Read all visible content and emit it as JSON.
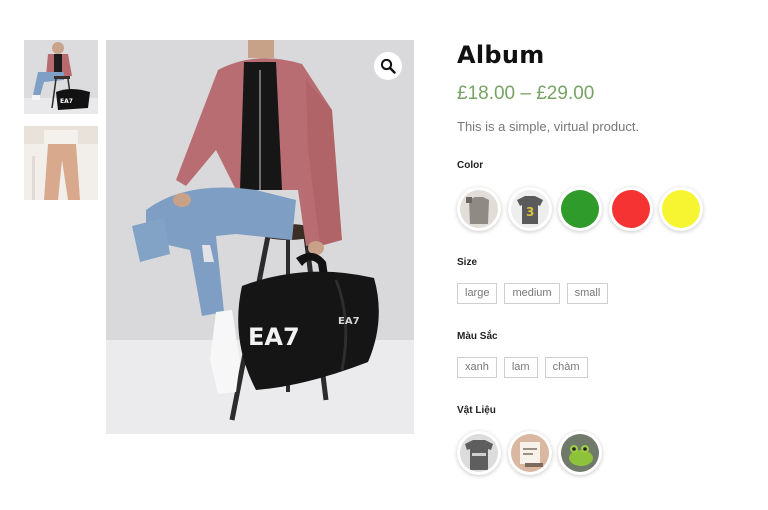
{
  "product": {
    "title": "Album",
    "price": "£18.00 – £29.00",
    "description": "This is a simple, virtual product."
  },
  "attributes": {
    "color": {
      "label": "Color",
      "swatches": [
        {
          "type": "image",
          "icon": "grey-tshirt-thumbnail"
        },
        {
          "type": "image",
          "icon": "grey-tshirt-number-3-thumbnail"
        },
        {
          "type": "color",
          "color": "#2e9b2a"
        },
        {
          "type": "color",
          "color": "#f53333"
        },
        {
          "type": "color",
          "color": "#f7f532"
        }
      ]
    },
    "size": {
      "label": "Size",
      "options": [
        "large",
        "medium",
        "small"
      ]
    },
    "mau_sac": {
      "label": "Màu Sắc",
      "options": [
        "xanh",
        "lam",
        "chàm"
      ]
    },
    "vat_lieu": {
      "label": "Vật Liệu",
      "swatches": [
        {
          "type": "image",
          "icon": "grey-tshirt-text-thumbnail"
        },
        {
          "type": "image",
          "icon": "notepad-thumbnail"
        },
        {
          "type": "image",
          "icon": "frog-thumbnail"
        }
      ]
    }
  },
  "gallery": {
    "thumbnails": [
      "model-with-duffel-bag-thumbnail",
      "pink-trousers-thumbnail"
    ],
    "main_image": "model-seated-with-black-ea7-duffel-bag",
    "bag_logo_text": "EA7",
    "zoom_icon": "magnifier-icon"
  }
}
